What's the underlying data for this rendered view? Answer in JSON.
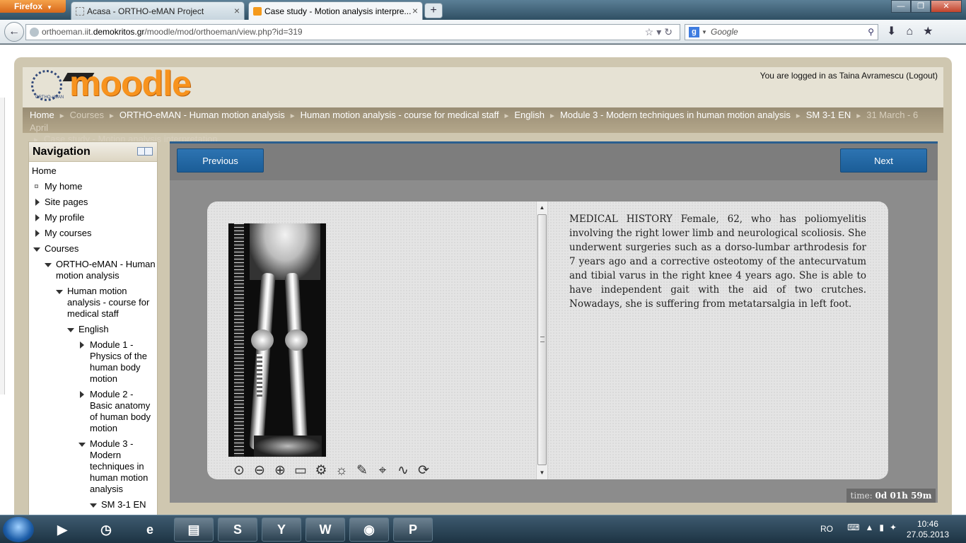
{
  "browser": {
    "menu_label": "Firefox",
    "tabs": [
      {
        "title": "Acasa - ORTHO-eMAN Project"
      },
      {
        "title": "Case study - Motion analysis interpre..."
      }
    ],
    "url_prefix": "orthoeman.iit.",
    "url_domain": "demokritos.gr",
    "url_path": "/moodle/mod/orthoeman/view.php?id=319",
    "search_placeholder": "Google"
  },
  "header": {
    "logo_text": "moodle",
    "seal_text": "ORTHO-eMAN",
    "logged_in_prefix": "You are logged in as",
    "user_name": "Taina Avramescu",
    "logout_label": "(Logout)"
  },
  "breadcrumb": [
    {
      "label": "Home",
      "dim": false
    },
    {
      "label": "Courses",
      "dim": true
    },
    {
      "label": "ORTHO-eMAN - Human motion analysis",
      "dim": false
    },
    {
      "label": "Human motion analysis - course for medical staff",
      "dim": false
    },
    {
      "label": "English",
      "dim": false
    },
    {
      "label": "Module 3 - Modern techniques in human motion analysis",
      "dim": false
    },
    {
      "label": "SM 3-1 EN",
      "dim": false
    },
    {
      "label": "31 March - 6 April",
      "dim": true
    },
    {
      "label": "Case study - Motion analysis interpretation",
      "dim": true
    }
  ],
  "navigation": {
    "title": "Navigation",
    "items": {
      "home": "Home",
      "my_home": "My home",
      "site_pages": "Site pages",
      "my_profile": "My profile",
      "my_courses": "My courses",
      "courses": "Courses",
      "ortho_course": "ORTHO-eMAN - Human motion analysis",
      "hma_course": "Human motion analysis - course for medical staff",
      "english": "English",
      "module1": "Module 1 - Physics of the human body motion",
      "module2": "Module 2 - Basic anatomy of human body motion",
      "module3": "Module 3 - Modern techniques in human motion analysis",
      "sm31": "SM 3-1 EN"
    }
  },
  "viewer": {
    "previous_label": "Previous",
    "next_label": "Next",
    "medical_history": "MEDICAL HISTORY Female, 62, who has poliomyelitis involving the right lower limb and neurological scoliosis. She underwent surgeries such as a dorso-lumbar arthrodesis for 7 years ago and a corrective osteotomy of the antecurvatum and tibial varus in the right knee 4 years ago. She is able to have independent gait with the aid of two crutches. Nowadays, she is suffering from metatarsalgia in left foot.",
    "timer_label": "time:",
    "timer_value": "0d 01h 59m",
    "tools": [
      "zoom-actual-size-icon",
      "zoom-out-icon",
      "zoom-in-icon",
      "fit-screen-icon",
      "settings-icon",
      "brightness-icon",
      "pen-icon",
      "crosshair-icon",
      "curve-icon",
      "reset-icon"
    ]
  },
  "taskbar": {
    "language": "RO",
    "time": "10:46",
    "date": "27.05.2013"
  }
}
